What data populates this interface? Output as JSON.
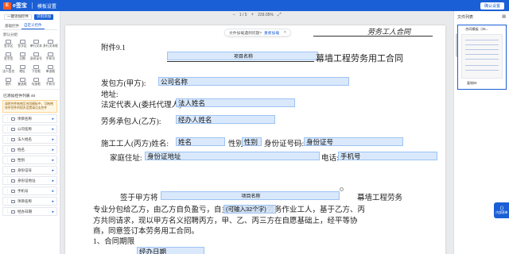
{
  "topbar": {
    "brand_logo": "E",
    "brand_name": "e签宝",
    "title": "模板设置",
    "confirm_label": "确认设置"
  },
  "left": {
    "add_label": "一键添加控件",
    "import_label": "识别添加",
    "tabs": [
      "基础控件",
      "自定义控件"
    ],
    "group_title": "默认分组",
    "controls": [
      {
        "label": "签字区"
      },
      {
        "label": "签字区"
      },
      {
        "label": "单行文本"
      },
      {
        "label": "多行文本框"
      },
      {
        "label": "签字签"
      },
      {
        "label": "日期"
      },
      {
        "label": "身份证号"
      },
      {
        "label": "手机号"
      },
      {
        "label": "法人签名"
      },
      {
        "label": "地址"
      },
      {
        "label": "下拉框"
      },
      {
        "label": "单选框"
      },
      {
        "label": "图片"
      },
      {
        "label": "复选框"
      },
      {
        "label": "勾选框"
      },
      {
        "label": "手机号"
      }
    ],
    "added_title": "已添加控件列表 40",
    "warning": "请将控件拖拽至合同模板中，可拖拽排序控件的相关设置请点击控件",
    "fields": [
      {
        "label": "项目名称"
      },
      {
        "label": "公司名称"
      },
      {
        "label": "法人姓名"
      },
      {
        "label": "姓名"
      },
      {
        "label": "性别"
      },
      {
        "label": "身份证号"
      },
      {
        "label": "身份证地址"
      },
      {
        "label": "手机号"
      },
      {
        "label": "项目名称"
      },
      {
        "label": "经办日期"
      }
    ]
  },
  "toolbar": {
    "zoom_out": "−",
    "page_info": "1 / 5",
    "zoom_in": "+",
    "zoom_level": "229.05%",
    "fit": "⤢"
  },
  "notice": {
    "text": "文件加载遇到问题?",
    "link": "重新加载"
  },
  "document": {
    "header_right": "劳务工人合同",
    "appendix": "附件9.1",
    "title_suffix": "幕墙工程劳务用工合同",
    "party_a_label": "发包方(甲方):",
    "address_label": "地址:",
    "legal_rep_label": "法定代表人(委托代理人):",
    "party_b_label": "劳务承包人(乙方):",
    "worker_label": "施工工人(丙方)姓名:",
    "gender_label": "性别",
    "id_label": "身份证号码:",
    "home_label": "家庭住址:",
    "phone_label": "电话:",
    "para1_prefix": "签于甲方将",
    "para1_suffix": "幕墙工程劳务",
    "para2": "专业分包给乙方，由乙方自负盈亏，自主组织招聘的劳务作业工人，基于乙方、丙",
    "para3": "方共同请求，现以甲方名义招聘丙方，甲、乙、丙三方在自愿基础上，经平等协",
    "para4": "商，同意签订本劳务用工合同。",
    "section1": "1、合同期限",
    "fields": {
      "project_name": "项目名称",
      "company_name": "公司名称",
      "legal_name": "法人姓名",
      "agent_name": "经办人姓名",
      "name": "姓名",
      "gender": "性别",
      "id_number": "身份证号",
      "id_address": "身份证地址",
      "phone": "手机号",
      "project_name_2": "项目名称",
      "input_hint": "(可输入32个字)",
      "date_partial": "经办日期"
    }
  },
  "right": {
    "title": "文件列表",
    "file_name": "合同模板（25...",
    "copy_label": "复制ID",
    "side_tab": "内部表单"
  }
}
